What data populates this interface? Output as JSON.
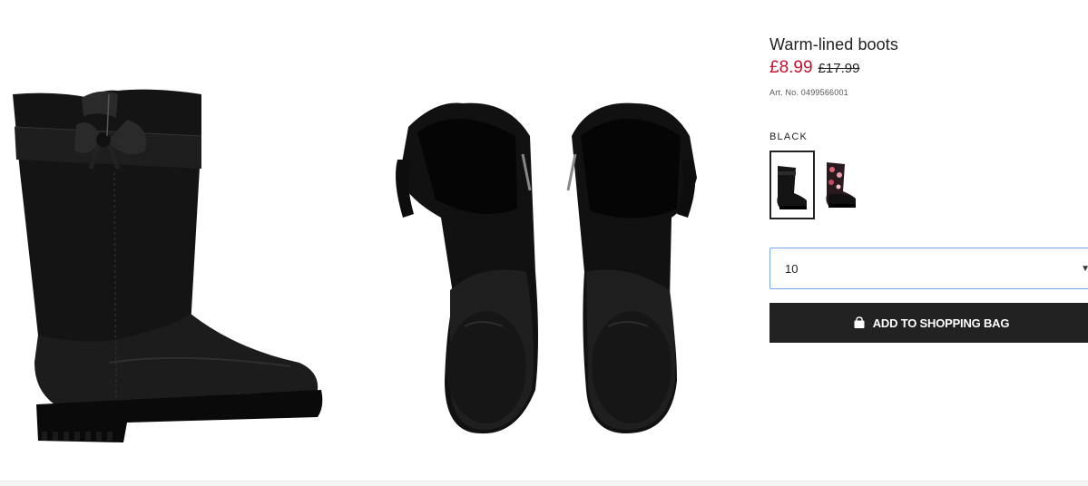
{
  "product": {
    "title": "Warm-lined boots",
    "price_sale": "£8.99",
    "price_original": "£17.99",
    "article_no": "Art. No. 0499566001"
  },
  "color": {
    "label": "BLACK",
    "swatches": [
      {
        "name": "Black",
        "selected": true
      },
      {
        "name": "Floral",
        "selected": false
      }
    ]
  },
  "size_select": {
    "value": "10",
    "icon": "chevron-down-icon"
  },
  "add_button": {
    "label": "ADD TO SHOPPING BAG",
    "icon": "shopping-bag-icon"
  },
  "colors": {
    "sale_price": "#c8102e",
    "button_bg": "#222222",
    "select_border": "#7aa7e8"
  }
}
